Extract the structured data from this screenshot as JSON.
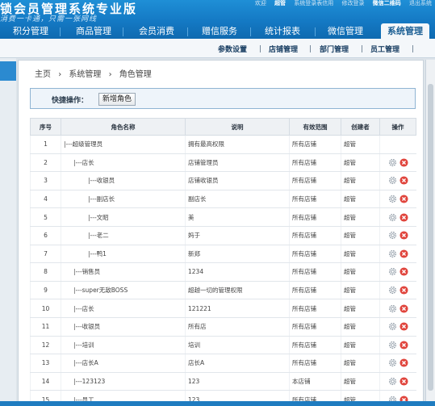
{
  "header": {
    "brand": "锁会员管理系统专业版",
    "slogan": "消费一卡通，只需一张网线",
    "toplinks": [
      "欢迎",
      "超管",
      "系统登录表信用",
      "修改登录",
      "微信二维码",
      "退出系统"
    ],
    "nav": [
      {
        "label": "积分管理"
      },
      {
        "label": "商品管理"
      },
      {
        "label": "会员消费"
      },
      {
        "label": "赠信服务"
      },
      {
        "label": "统计报表"
      },
      {
        "label": "微信管理"
      },
      {
        "label": "系统管理",
        "active": true
      }
    ]
  },
  "subnav": [
    "参数设置",
    "店铺管理",
    "部门管理",
    "员工管理"
  ],
  "breadcrumb": [
    "主页",
    "系统管理",
    "角色管理"
  ],
  "quick": {
    "label": "快捷操作：",
    "button": "新增角色"
  },
  "table": {
    "headers": [
      "序号",
      "角色名称",
      "说明",
      "有效范围",
      "创建者",
      "操作"
    ],
    "rows": [
      {
        "no": "1",
        "name": "|---超级管理员",
        "desc": "拥有最高权限",
        "scope": "所有店铺",
        "creator": "超管",
        "ops": false
      },
      {
        "no": "2",
        "name": "|---店长",
        "desc": "店铺管理员",
        "scope": "所有店铺",
        "creator": "超管",
        "ops": true
      },
      {
        "no": "3",
        "name": "|---收银员",
        "desc": "店铺收银员",
        "scope": "所有店铺",
        "creator": "超管",
        "ops": true
      },
      {
        "no": "4",
        "name": "|---副店长",
        "desc": "副店长",
        "scope": "所有店铺",
        "creator": "超管",
        "ops": true
      },
      {
        "no": "5",
        "name": "|---文昭",
        "desc": "美",
        "scope": "所有店铺",
        "creator": "超管",
        "ops": true
      },
      {
        "no": "6",
        "name": "|---老二",
        "desc": "妈于",
        "scope": "所有店铺",
        "creator": "超管",
        "ops": true
      },
      {
        "no": "7",
        "name": "|---鸭1",
        "desc": "新郑",
        "scope": "所有店铺",
        "creator": "超管",
        "ops": true
      },
      {
        "no": "8",
        "name": "|---销售员",
        "desc": "1234",
        "scope": "所有店铺",
        "creator": "超管",
        "ops": true
      },
      {
        "no": "9",
        "name": "|---super无敌BOSS",
        "desc": "超越一切的管理权限",
        "scope": "所有店铺",
        "creator": "超管",
        "ops": true
      },
      {
        "no": "10",
        "name": "|---店长",
        "desc": "121221",
        "scope": "所有店铺",
        "creator": "超管",
        "ops": true
      },
      {
        "no": "11",
        "name": "|---收银员",
        "desc": "所有店",
        "scope": "所有店铺",
        "creator": "超管",
        "ops": true
      },
      {
        "no": "12",
        "name": "|---培训",
        "desc": "培训",
        "scope": "所有店铺",
        "creator": "超管",
        "ops": true
      },
      {
        "no": "13",
        "name": "|---店长A",
        "desc": "店长A",
        "scope": "所有店铺",
        "creator": "超管",
        "ops": true
      },
      {
        "no": "14",
        "name": "|---123123",
        "desc": "123",
        "scope": "本店铺",
        "creator": "超管",
        "ops": true
      },
      {
        "no": "15",
        "name": "|---员工",
        "desc": "123",
        "scope": "所有店铺",
        "creator": "超管",
        "ops": true
      }
    ]
  },
  "colors": {
    "header": "#1479c4",
    "accent": "#2b8ad0",
    "danger": "#e0443c"
  },
  "icons": {
    "edit": "gear-icon",
    "delete": "delete-icon"
  }
}
